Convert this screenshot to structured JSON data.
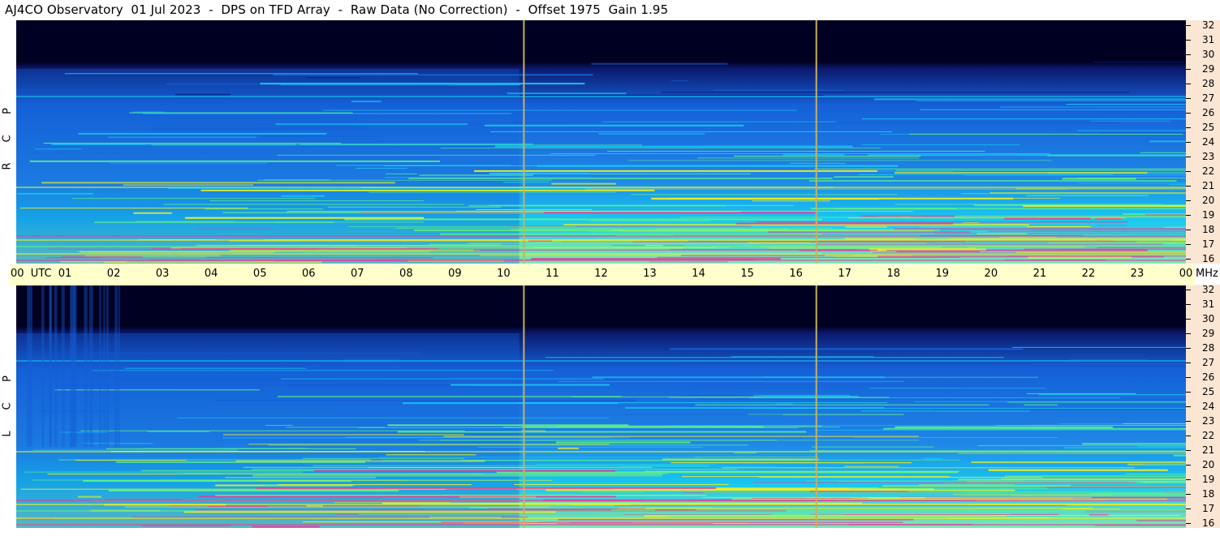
{
  "title": "AJ4CO Observatory  01 Jul 2023  -  DPS on TFD Array  -  Raw Data (No Correction)  -  Offset 1975  Gain 1.95",
  "panels": [
    {
      "label_letters": [
        "P",
        "C",
        "R"
      ]
    },
    {
      "label_letters": [
        "P",
        "C",
        "L"
      ]
    }
  ],
  "time_axis": {
    "labels": [
      "00  UTC",
      "01",
      "02",
      "03",
      "04",
      "05",
      "06",
      "07",
      "08",
      "09",
      "10",
      "11",
      "12",
      "13",
      "14",
      "15",
      "16",
      "17",
      "18",
      "19",
      "20",
      "21",
      "22",
      "23",
      "00"
    ],
    "unit": "MHz"
  },
  "freq_axis": {
    "labels": [
      "32",
      "31",
      "30",
      "29",
      "28",
      "27",
      "26",
      "25",
      "24",
      "23",
      "22",
      "21",
      "20",
      "19",
      "18",
      "17",
      "16"
    ]
  },
  "chart_data": {
    "type": "heatmap",
    "title": "AJ4CO Observatory  01 Jul 2023  -  DPS on TFD Array  -  Raw Data (No Correction)  -  Offset 1975  Gain 1.95",
    "x_range_utc_hours": [
      0,
      24
    ],
    "y_range_mhz": [
      16,
      32
    ],
    "x_ticks": [
      "00",
      "01",
      "02",
      "03",
      "04",
      "05",
      "06",
      "07",
      "08",
      "09",
      "10",
      "11",
      "12",
      "13",
      "14",
      "15",
      "16",
      "17",
      "18",
      "19",
      "20",
      "21",
      "22",
      "23",
      "00"
    ],
    "y_ticks": [
      32,
      31,
      30,
      29,
      28,
      27,
      26,
      25,
      24,
      23,
      22,
      21,
      20,
      19,
      18,
      17,
      16
    ],
    "y_unit": "MHz",
    "panels": [
      "RCP",
      "LCP"
    ],
    "data_gaps_utc_hours": [
      10.4,
      16.4
    ],
    "colors": {
      "background_low": "#000022",
      "deep": "#0b1a6e",
      "mid": "#1560d8",
      "cyan": "#18c8f0",
      "green": "#5ef08a",
      "yellow": "#f0f020",
      "magenta": "#e040a0",
      "gap_line": "#c8b060"
    }
  }
}
